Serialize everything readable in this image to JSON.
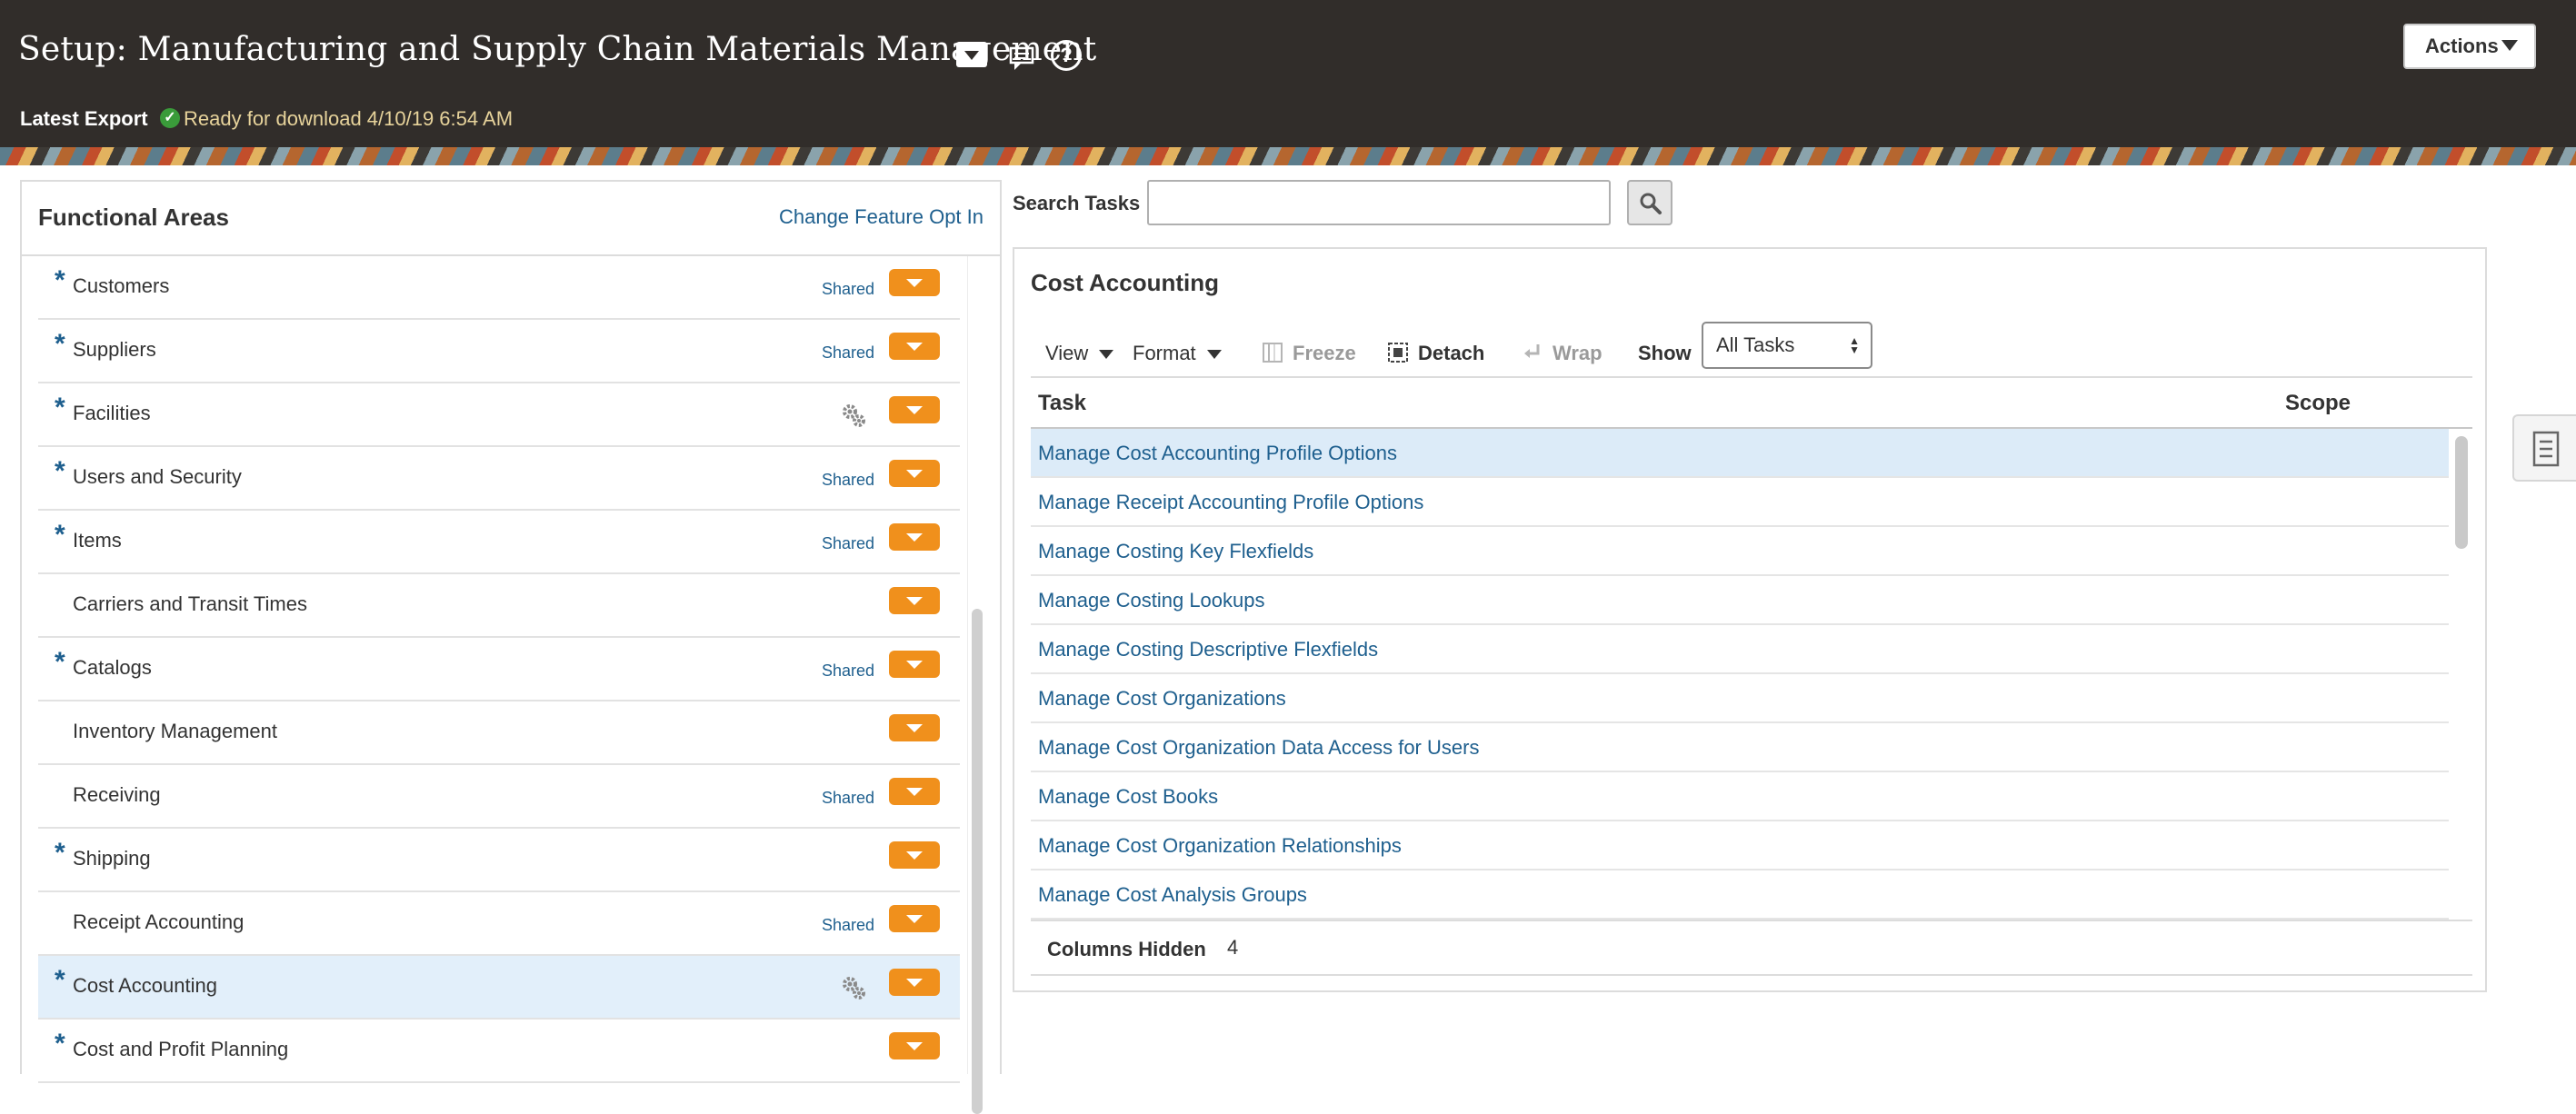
{
  "header": {
    "title": "Setup: Manufacturing and Supply Chain Materials Management",
    "actions_label": "Actions",
    "export_label": "Latest Export",
    "export_status": "Ready for download 4/10/19 6:54 AM"
  },
  "left_panel": {
    "title": "Functional Areas",
    "feature_link": "Change Feature Opt In",
    "items": [
      {
        "label": "Customers",
        "required": true,
        "shared": "Shared",
        "gears": false,
        "selected": false
      },
      {
        "label": "Suppliers",
        "required": true,
        "shared": "Shared",
        "gears": false,
        "selected": false
      },
      {
        "label": "Facilities",
        "required": true,
        "shared": "",
        "gears": true,
        "selected": false
      },
      {
        "label": "Users and Security",
        "required": true,
        "shared": "Shared",
        "gears": false,
        "selected": false
      },
      {
        "label": "Items",
        "required": true,
        "shared": "Shared",
        "gears": false,
        "selected": false
      },
      {
        "label": "Carriers and Transit Times",
        "required": false,
        "shared": "",
        "gears": false,
        "selected": false
      },
      {
        "label": "Catalogs",
        "required": true,
        "shared": "Shared",
        "gears": false,
        "selected": false
      },
      {
        "label": "Inventory Management",
        "required": false,
        "shared": "",
        "gears": false,
        "selected": false
      },
      {
        "label": "Receiving",
        "required": false,
        "shared": "Shared",
        "gears": false,
        "selected": false
      },
      {
        "label": "Shipping",
        "required": true,
        "shared": "",
        "gears": false,
        "selected": false
      },
      {
        "label": "Receipt Accounting",
        "required": false,
        "shared": "Shared",
        "gears": false,
        "selected": false
      },
      {
        "label": "Cost Accounting",
        "required": true,
        "shared": "",
        "gears": true,
        "selected": true
      },
      {
        "label": "Cost and Profit Planning",
        "required": true,
        "shared": "",
        "gears": false,
        "selected": false
      }
    ]
  },
  "search": {
    "label": "Search Tasks",
    "value": ""
  },
  "task_panel": {
    "title": "Cost Accounting",
    "toolbar": {
      "view": "View",
      "format": "Format",
      "freeze": "Freeze",
      "detach": "Detach",
      "wrap": "Wrap",
      "show_label": "Show",
      "show_value": "All Tasks"
    },
    "columns": {
      "task": "Task",
      "scope": "Scope"
    },
    "tasks": [
      "Manage Cost Accounting Profile Options",
      "Manage Receipt Accounting Profile Options",
      "Manage Costing Key Flexfields",
      "Manage Costing Lookups",
      "Manage Costing Descriptive Flexfields",
      "Manage Cost Organizations",
      "Manage Cost Organization Data Access for Users",
      "Manage Cost Books",
      "Manage Cost Organization Relationships",
      "Manage Cost Analysis Groups"
    ],
    "selected_task_index": 0,
    "columns_hidden_label": "Columns Hidden",
    "columns_hidden_count": "4"
  },
  "colors": {
    "header_bg": "#312d2a",
    "link": "#1e5f8e",
    "menu_button": "#f0901c",
    "selected_row": "#e2effa",
    "export_status": "#e7d39b"
  },
  "icons": [
    "title-menu-icon",
    "chat-icon",
    "help-icon",
    "check-icon",
    "gears-icon",
    "search-icon",
    "freeze-icon",
    "detach-icon",
    "wrap-icon",
    "panel-drawer-icon"
  ]
}
